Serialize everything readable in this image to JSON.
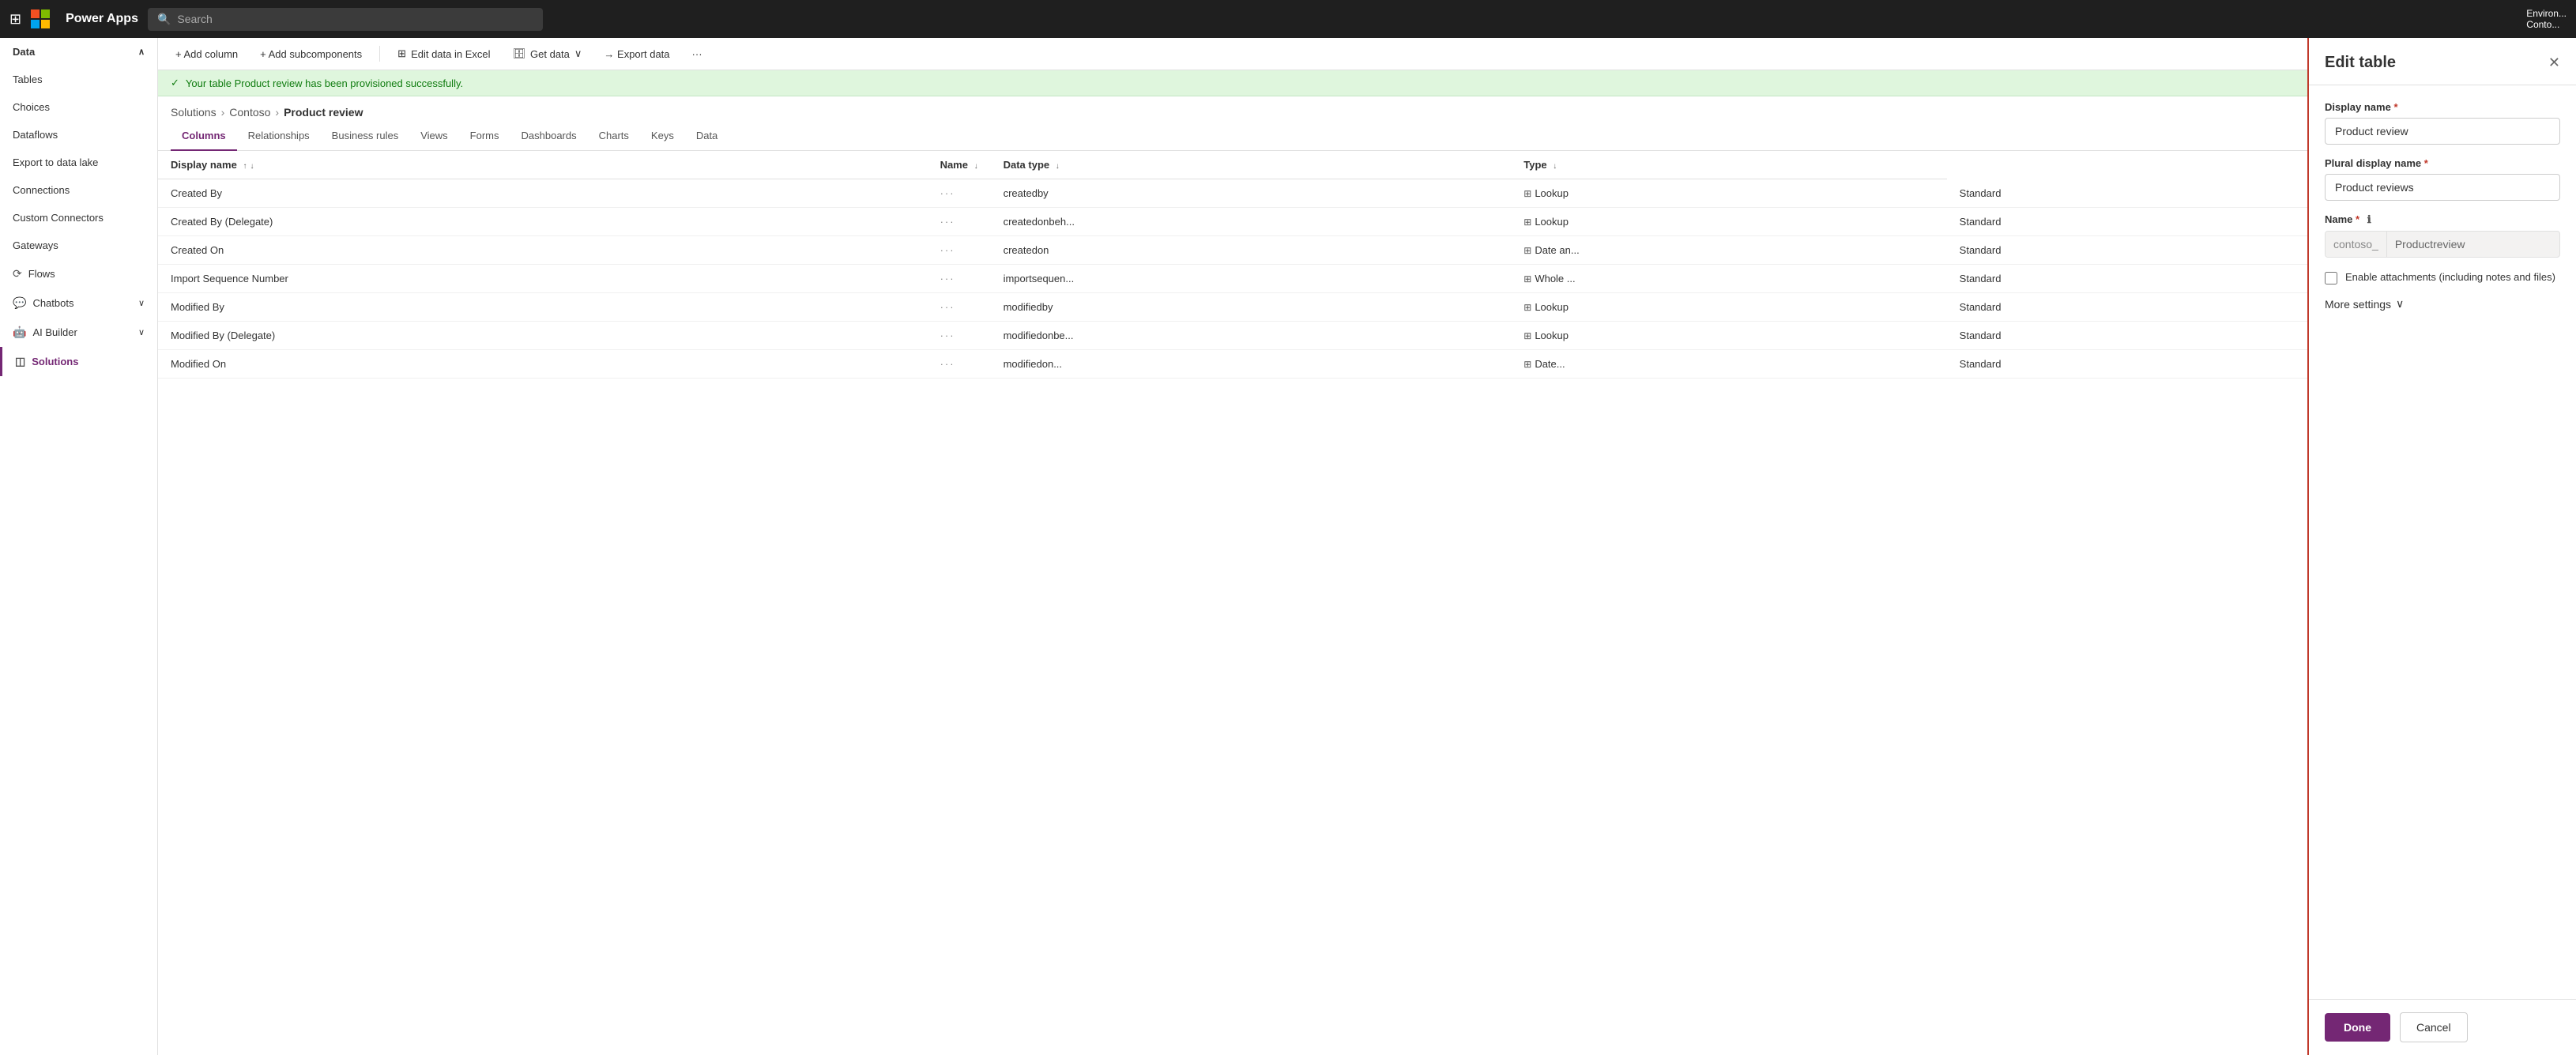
{
  "topnav": {
    "app_name": "Power Apps",
    "search_placeholder": "Search",
    "env_label": "Environ...",
    "tenant_label": "Conto..."
  },
  "sidebar": {
    "section_header": "Data",
    "items": [
      {
        "id": "tables",
        "label": "Tables",
        "icon": ""
      },
      {
        "id": "choices",
        "label": "Choices",
        "icon": ""
      },
      {
        "id": "dataflows",
        "label": "Dataflows",
        "icon": ""
      },
      {
        "id": "export",
        "label": "Export to data lake",
        "icon": ""
      },
      {
        "id": "connections",
        "label": "Connections",
        "icon": ""
      },
      {
        "id": "connectors",
        "label": "Custom Connectors",
        "icon": ""
      },
      {
        "id": "gateways",
        "label": "Gateways",
        "icon": ""
      },
      {
        "id": "flows",
        "label": "Flows",
        "icon": "⟳"
      },
      {
        "id": "chatbots",
        "label": "Chatbots",
        "icon": "💬"
      },
      {
        "id": "aibuilder",
        "label": "AI Builder",
        "icon": "🤖"
      },
      {
        "id": "solutions",
        "label": "Solutions",
        "icon": "◫"
      }
    ]
  },
  "toolbar": {
    "add_column": "+ Add column",
    "add_subcomponents": "+ Add subcomponents",
    "edit_excel": "Edit data in Excel",
    "get_data": "Get data",
    "export_data": "→ Export data"
  },
  "banner": {
    "message": "Your table Product review has been provisioned successfully."
  },
  "breadcrumb": {
    "solutions": "Solutions",
    "contoso": "Contoso",
    "current": "Product review"
  },
  "tabs": [
    {
      "id": "columns",
      "label": "Columns",
      "active": true
    },
    {
      "id": "relationships",
      "label": "Relationships",
      "active": false
    },
    {
      "id": "business_rules",
      "label": "Business rules",
      "active": false
    },
    {
      "id": "views",
      "label": "Views",
      "active": false
    },
    {
      "id": "forms",
      "label": "Forms",
      "active": false
    },
    {
      "id": "dashboards",
      "label": "Dashboards",
      "active": false
    },
    {
      "id": "charts",
      "label": "Charts",
      "active": false
    },
    {
      "id": "keys",
      "label": "Keys",
      "active": false
    },
    {
      "id": "data",
      "label": "Data",
      "active": false
    }
  ],
  "table": {
    "columns": [
      {
        "id": "display_name",
        "label": "Display name"
      },
      {
        "id": "name",
        "label": "Name"
      },
      {
        "id": "data_type",
        "label": "Data type"
      },
      {
        "id": "type",
        "label": "Type"
      }
    ],
    "rows": [
      {
        "display_name": "Created By",
        "dots": "···",
        "name": "createdby",
        "data_type": "Lookup",
        "type": "Standard"
      },
      {
        "display_name": "Created By (Delegate)",
        "dots": "···",
        "name": "createdonbeh...",
        "data_type": "Lookup",
        "type": "Standard"
      },
      {
        "display_name": "Created On",
        "dots": "···",
        "name": "createdon",
        "data_type": "Date an...",
        "type": "Standard"
      },
      {
        "display_name": "Import Sequence Number",
        "dots": "···",
        "name": "importsequen...",
        "data_type": "Whole ...",
        "type": "Standard"
      },
      {
        "display_name": "Modified By",
        "dots": "···",
        "name": "modifiedby",
        "data_type": "Lookup",
        "type": "Standard"
      },
      {
        "display_name": "Modified By (Delegate)",
        "dots": "···",
        "name": "modifiedonbe...",
        "data_type": "Lookup",
        "type": "Standard"
      },
      {
        "display_name": "Modified On",
        "dots": "···",
        "name": "modifiedon...",
        "data_type": "Date...",
        "type": "Standard"
      }
    ]
  },
  "edit_panel": {
    "title": "Edit table",
    "display_name_label": "Display name",
    "display_name_value": "Product review",
    "plural_label": "Plural display name",
    "plural_value": "Product reviews",
    "name_label": "Name",
    "name_prefix": "contoso_",
    "name_value": "Productreview",
    "enable_attachments_label": "Enable attachments (including notes and files)",
    "more_settings_label": "More settings",
    "done_label": "Done",
    "cancel_label": "Cancel"
  }
}
